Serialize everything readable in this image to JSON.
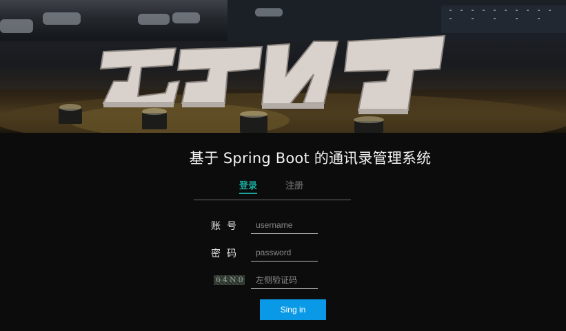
{
  "banner": {
    "alt": "云塔广场 night photo"
  },
  "header": {
    "title": "基于 Spring Boot 的通讯录管理系统"
  },
  "tabs": [
    {
      "label": "登录",
      "active": true
    },
    {
      "label": "注册",
      "active": false
    }
  ],
  "form": {
    "username": {
      "label": "账号",
      "placeholder": "username",
      "value": ""
    },
    "password": {
      "label": "密码",
      "placeholder": "password",
      "value": ""
    },
    "captcha": {
      "code": "64N0",
      "placeholder": "左侧验证码",
      "value": ""
    }
  },
  "actions": {
    "signin_label": "Sing in"
  },
  "colors": {
    "accent": "#19a79a",
    "button": "#0a99e6",
    "background": "#0c0c0c"
  }
}
